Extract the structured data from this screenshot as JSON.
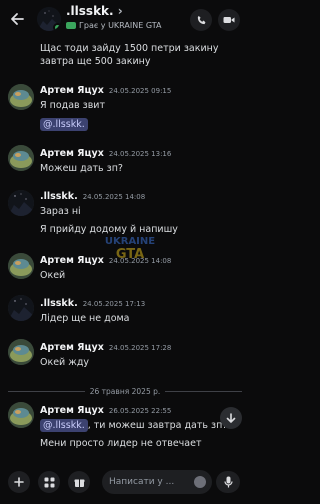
{
  "header": {
    "title": ".llsskk.",
    "chevron": "›",
    "status": "Грає у UKRAINE GTA"
  },
  "messages": {
    "top_line": "Щас тоди зайду 1500 петри закину завтра ще 500 закину",
    "g1": {
      "author": "Артем Яцух",
      "time": "24.05.2025 09:15",
      "text": "Я подав звит",
      "mention": "@.llsskk."
    },
    "g2": {
      "author": "Артем Яцух",
      "time": "24.05.2025 13:16",
      "text": "Можеш дать зп?"
    },
    "g3": {
      "author": ".llsskk.",
      "time": "24.05.2025 14:08",
      "line1": "Зараз ні",
      "line2": "Я прийду додому й напишу"
    },
    "g4": {
      "author": "Артем Яцух",
      "time": "24.05.2025 14:08",
      "text": "Окей"
    },
    "g5": {
      "author": ".llsskk.",
      "time": "24.05.2025 17:13",
      "text": "Лідер ще не дома"
    },
    "g6": {
      "author": "Артем Яцух",
      "time": "24.05.2025 17:28",
      "text": "Окей жду"
    },
    "divider": "26 травня 2025 р.",
    "g7": {
      "author": "Артем Яцух",
      "time": "26.05.2025 22:55",
      "mention": "@.llsskk.",
      "text_after_mention": ", ти можеш завтра дать зп?",
      "line2": "Мени просто лидер не отвечает"
    }
  },
  "composer": {
    "placeholder": "Написати у ..."
  },
  "icons": [
    "back-arrow-icon",
    "phone-icon",
    "video-icon",
    "plus-icon",
    "apps-icon",
    "gift-icon",
    "emoji-icon",
    "mic-icon",
    "chevron-down-icon",
    "game-controller-icon"
  ],
  "colors": {
    "background": "#0b0b0c",
    "online": "#3ba55d",
    "mention_bg": "#3c4270",
    "mention_text": "#c9cdfb"
  }
}
